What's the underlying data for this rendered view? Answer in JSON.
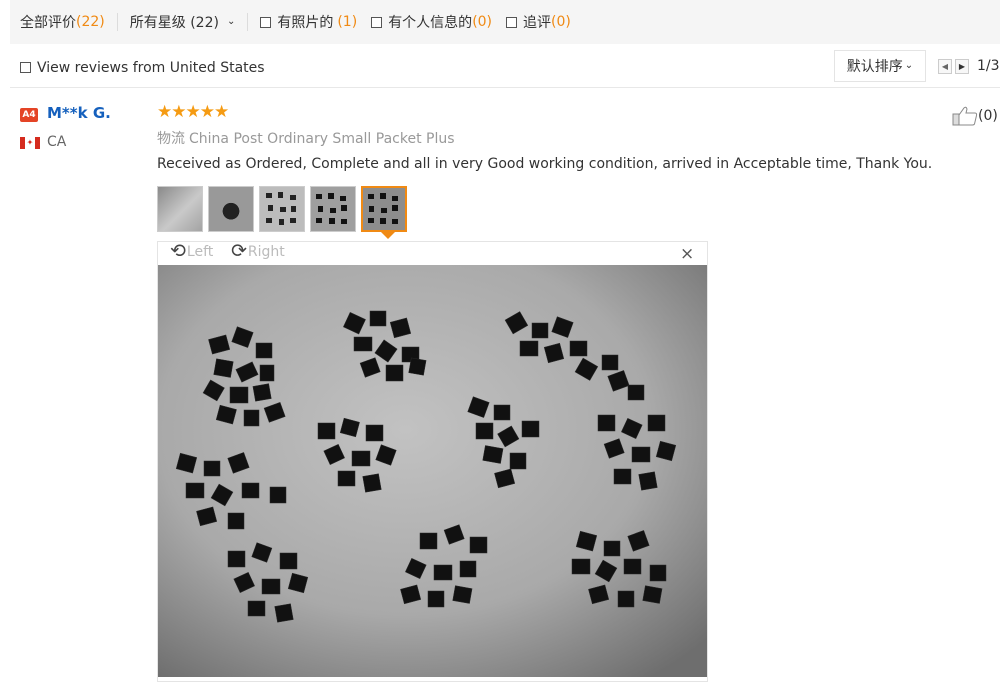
{
  "filters": {
    "all_label": "全部评价",
    "all_count": "(22)",
    "stars_label": "所有星级 (22)",
    "with_photos_label": "有照片的",
    "with_photos_count": "(1)",
    "personal_info_label": "有个人信息的",
    "personal_info_count": "(0)",
    "followup_label": "追评",
    "followup_count": "(0)"
  },
  "country_filter": {
    "label": "View reviews from United States"
  },
  "sort": {
    "label": "默认排序"
  },
  "pagination": {
    "text": "1/3"
  },
  "review": {
    "user_level": "A4",
    "user_name": "M**k G.",
    "country": "CA",
    "stars": 5,
    "logistics_label": "物流",
    "logistics_value": "China Post Ordinary Small Packet Plus",
    "text": "Received as Ordered, Complete and all in very Good working condition, arrived in Acceptable time, Thank You.",
    "helpful_count": "(0)",
    "photo_count": 5,
    "active_photo": 5
  },
  "viewer": {
    "rotate_left_label": "Left",
    "rotate_right_label": "Right",
    "close_symbol": "×"
  },
  "icons": {
    "helpful": "thumbs-up-icon",
    "rotate_left": "rotate-left-icon",
    "rotate_right": "rotate-right-icon",
    "close": "close-icon",
    "flag": "canada-flag-icon"
  },
  "colors": {
    "accent": "#f08a14",
    "user_link": "#1560bd",
    "star": "#f59b13",
    "level_badge": "#e44426"
  }
}
